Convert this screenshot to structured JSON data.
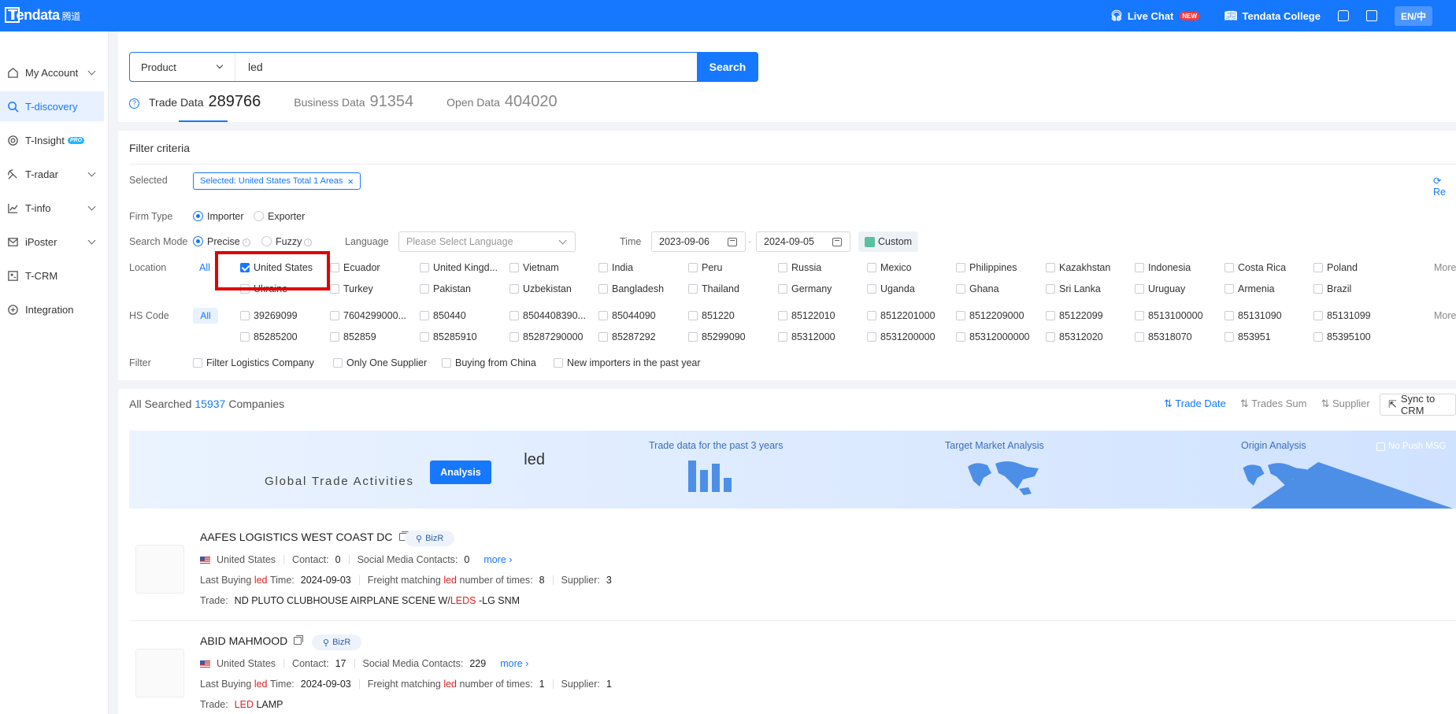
{
  "header": {
    "logo_text": "Tendata",
    "logo_cn": "腾道",
    "live_chat": "Live Chat",
    "new_badge": "NEW",
    "college": "Tendata College",
    "lang": "EN/中"
  },
  "sidebar": {
    "items": [
      {
        "label": "My Account"
      },
      {
        "label": "T-discovery"
      },
      {
        "label": "T-Insight",
        "badge": "PRO"
      },
      {
        "label": "T-radar"
      },
      {
        "label": "T-info"
      },
      {
        "label": "iPoster"
      },
      {
        "label": "T-CRM"
      },
      {
        "label": "Integration"
      }
    ]
  },
  "search": {
    "type": "Product",
    "value": "led",
    "button": "Search"
  },
  "tabs": [
    {
      "label": "Trade Data",
      "count": "289766"
    },
    {
      "label": "Business Data",
      "count": "91354"
    },
    {
      "label": "Open Data",
      "count": "404020"
    }
  ],
  "filter": {
    "title": "Filter criteria",
    "selected_label": "Selected",
    "selected_tag": "Selected: United States Total 1 Areas",
    "reset": "Re",
    "firm_type_label": "Firm Type",
    "firm_importer": "Importer",
    "firm_exporter": "Exporter",
    "search_mode_label": "Search Mode",
    "mode_precise": "Precise",
    "mode_fuzzy": "Fuzzy",
    "language_label": "Language",
    "language_placeholder": "Please Select Language",
    "time_label": "Time",
    "date_from": "2023-09-06",
    "date_to": "2024-09-05",
    "custom": "Custom",
    "location_label": "Location",
    "all": "All",
    "more": "More",
    "locations_row1": [
      "United States",
      "Ecuador",
      "United Kingd...",
      "Vietnam",
      "India",
      "Peru",
      "Russia",
      "Mexico",
      "Philippines",
      "Kazakhstan",
      "Indonesia",
      "Costa Rica",
      "Poland"
    ],
    "locations_row2": [
      "Ukraine",
      "Turkey",
      "Pakistan",
      "Uzbekistan",
      "Bangladesh",
      "Thailand",
      "Germany",
      "Uganda",
      "Ghana",
      "Sri Lanka",
      "Uruguay",
      "Armenia",
      "Brazil"
    ],
    "hs_label": "HS Code",
    "hs_row1": [
      "39269099",
      "7604299000...",
      "850440",
      "8504408390...",
      "85044090",
      "851220",
      "85122010",
      "8512201000",
      "8512209000",
      "85122099",
      "8513100000",
      "85131090",
      "85131099"
    ],
    "hs_row2": [
      "85285200",
      "852859",
      "85285910",
      "85287290000",
      "85287292",
      "85299090",
      "85312000",
      "8531200000",
      "85312000000",
      "85312020",
      "85318070",
      "853951",
      "85395100"
    ],
    "filter_label": "Filter",
    "filter_opts": [
      "Filter Logistics Company",
      "Only One Supplier",
      "Buying from China",
      "New importers in the past year"
    ]
  },
  "results": {
    "prefix": "All Searched",
    "count": "15937",
    "suffix": "Companies",
    "sort": [
      "Trade Date",
      "Trades Sum",
      "Supplier"
    ],
    "sync": "Sync to CRM"
  },
  "banner": {
    "keyword": "led",
    "subtitle": "Global Trade Activities",
    "analysis": "Analysis",
    "cap1": "Trade data for the past 3 years",
    "cap2": "Target Market Analysis",
    "cap3": "Origin Analysis",
    "nopush": "No Push MSG"
  },
  "companies": [
    {
      "name": "AAFES LOGISTICS WEST COAST DC",
      "bizr": "BizR",
      "country": "United States",
      "contact_label": "Contact:",
      "contact": "0",
      "social_label": "Social Media Contacts:",
      "social": "0",
      "more": "more",
      "last_buying_pre": "Last Buying",
      "kw": "led",
      "last_buying_post": "Time:",
      "last_date": "2024-09-03",
      "freight_pre": "Freight matching",
      "freight_post": "number of times:",
      "freight": "8",
      "supplier_label": "Supplier:",
      "supplier": "3",
      "trade_label": "Trade:",
      "trade_pre": "ND PLUTO CLUBHOUSE AIRPLANE SCENE W/",
      "trade_hl": "LEDS",
      "trade_post": "-LG SNM"
    },
    {
      "name": "ABID MAHMOOD",
      "bizr": "BizR",
      "country": "United States",
      "contact_label": "Contact:",
      "contact": "17",
      "social_label": "Social Media Contacts:",
      "social": "229",
      "more": "more",
      "last_buying_pre": "Last Buying",
      "kw": "led",
      "last_buying_post": "Time:",
      "last_date": "2024-09-03",
      "freight_pre": "Freight matching",
      "freight_post": "number of times:",
      "freight": "1",
      "supplier_label": "Supplier:",
      "supplier": "1",
      "trade_label": "Trade:",
      "trade_pre": "",
      "trade_hl": "LED",
      "trade_post": "LAMP"
    }
  ]
}
